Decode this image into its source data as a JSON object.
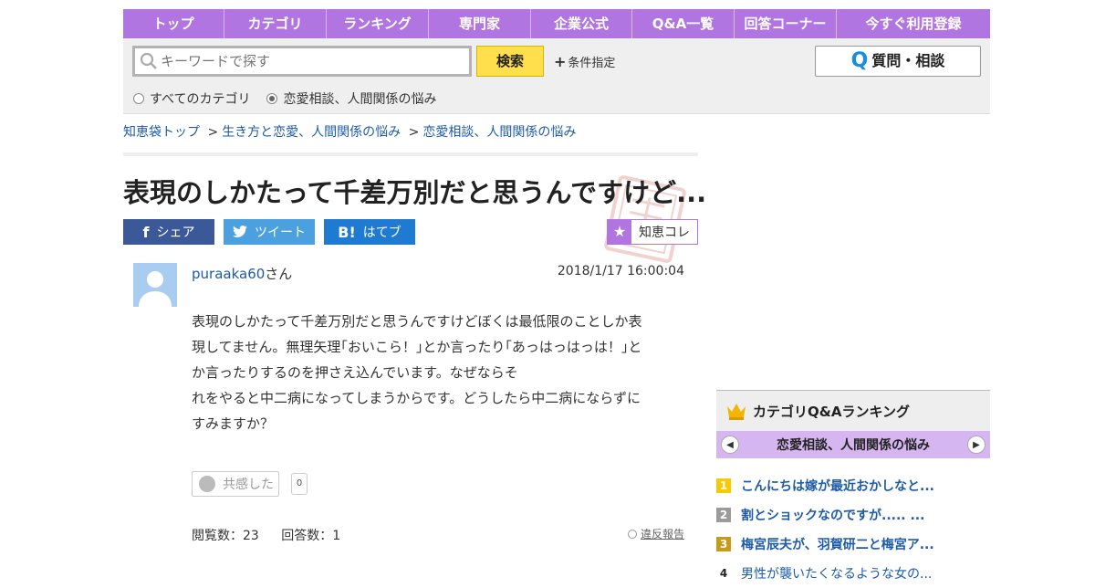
{
  "nav": [
    "トップ",
    "カテゴリ",
    "ランキング",
    "専門家",
    "企業公式",
    "Q&A一覧",
    "回答コーナー",
    "今すぐ利用登録"
  ],
  "search": {
    "placeholder": "キーワードで探す",
    "button": "検索",
    "condition": "条件指定",
    "ask_button": "質問・相談",
    "radios": [
      "すべてのカテゴリ",
      "恋愛相談、人間関係の悩み"
    ],
    "selected_radio": 1
  },
  "breadcrumb": [
    "知恵袋トップ",
    "生き方と恋愛、人間関係の悩み",
    "恋愛相談、人間関係の悩み"
  ],
  "question": {
    "title": "表現のしかたって千差万別だと思うんですけど...",
    "user": "puraaka60",
    "user_suffix": "さん",
    "date": "2018/1/17  16:00:04",
    "body_lines": [
      "表現のしかたって千差万別だと思うんですけどぼくは最低限のことしか表",
      "現してません。無理矢理｢おいこら！｣とか言ったり｢あっはっはっは！｣と",
      "か言ったりするのを押さえ込んでいます。なぜならそ",
      "れをやると中二病になってしまうからです。どうしたら中二病にならずに",
      "すみますか？"
    ],
    "kyokan_label": "共感した",
    "kyokan_count": "0",
    "views_label": "閲覧数：23",
    "answers_label": "回答数：1",
    "report": "違反報告"
  },
  "share": {
    "facebook": "シェア",
    "twitter": "ツイート",
    "hatena": "はてブ",
    "chiekore": "知恵コレ"
  },
  "sidebar": {
    "title": "カテゴリQ&Aランキング",
    "category": "恋愛相談、人間関係の悩み",
    "ranking": [
      {
        "rank": "1",
        "text": "こんにちは嫁が最近おかしなと...",
        "color": "#f6c900"
      },
      {
        "rank": "2",
        "text": "割とショックなのですが..... ...",
        "color": "#9b9b9b"
      },
      {
        "rank": "3",
        "text": "梅宮辰夫が、羽賀研二と梅宮ア...",
        "color": "#c79a1c"
      },
      {
        "rank": "4",
        "text": "男性が襲いたくなるような女の...",
        "color": ""
      }
    ]
  },
  "colors": {
    "accent": "#b075e0",
    "link": "#1d5ba8",
    "search_button": "#ffe04c",
    "facebook": "#3b5998",
    "twitter": "#4ba1e0",
    "hatena": "#1f7bd1"
  }
}
